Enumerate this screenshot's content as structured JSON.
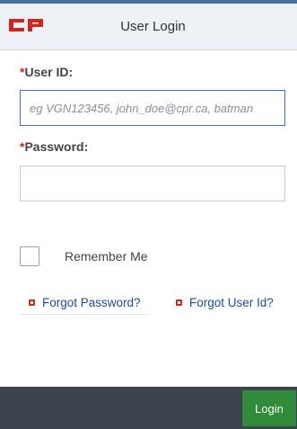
{
  "header": {
    "logo_text": "CP",
    "title": "User Login"
  },
  "form": {
    "user_id": {
      "required_mark": "*",
      "label": "User ID:",
      "placeholder": "eg VGN123456, john_doe@cpr.ca, batman",
      "value": ""
    },
    "password": {
      "required_mark": "*",
      "label": "Password:",
      "placeholder": "",
      "value": ""
    },
    "remember_me": {
      "label": "Remember Me",
      "checked": false
    }
  },
  "links": {
    "forgot_password": "Forgot Password?",
    "forgot_user_id": "Forgot User Id?"
  },
  "footer": {
    "login_label": "Login"
  },
  "colors": {
    "brand_red": "#d0271d",
    "link_blue": "#1b4f91",
    "footer_bg": "#3b444f",
    "login_green": "#2f8a3a",
    "focus_blue": "#3f73c9"
  }
}
